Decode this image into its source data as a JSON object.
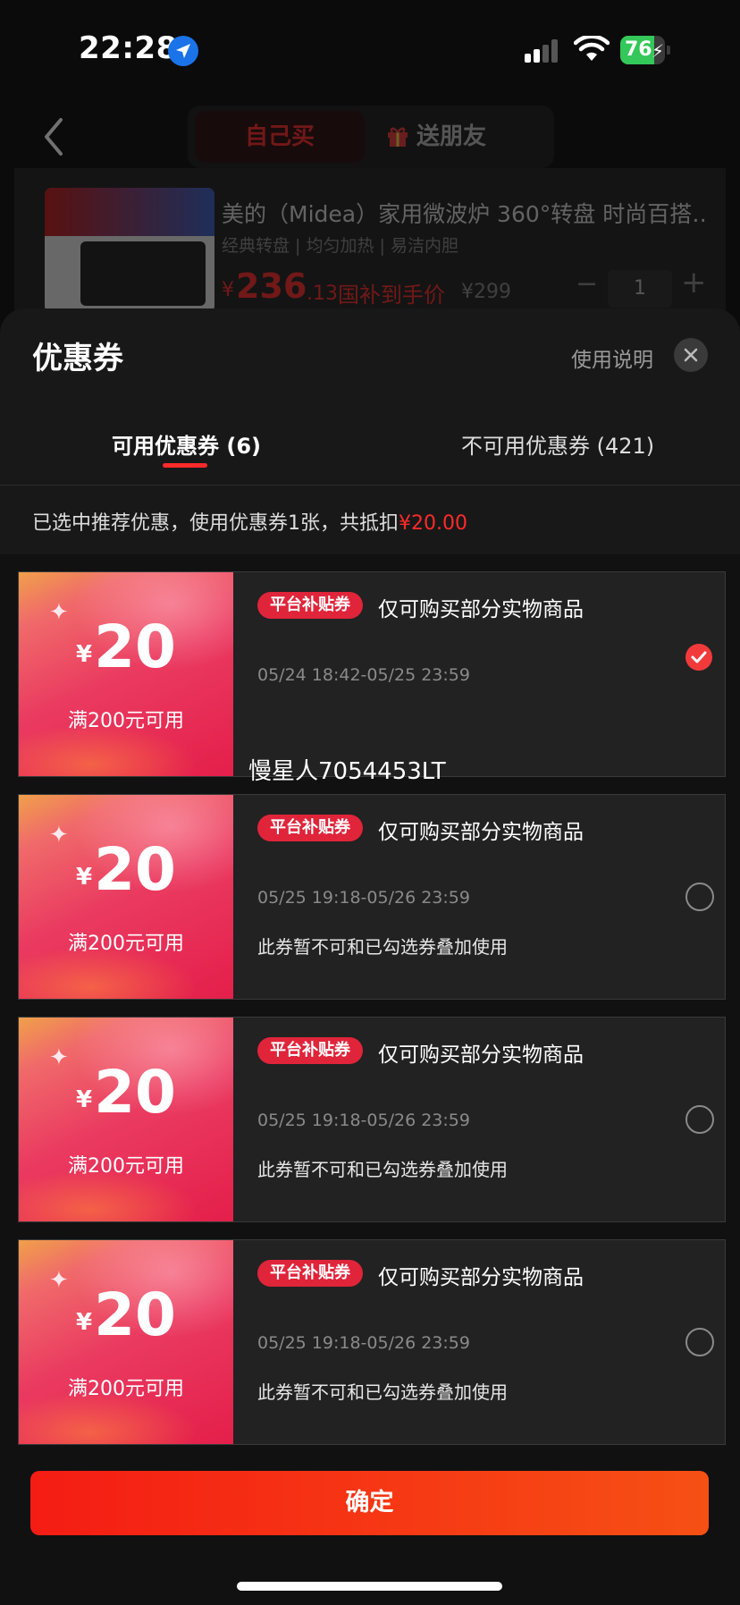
{
  "status_bar": {
    "time": "22:28",
    "battery": "76",
    "battery_level": 0.76
  },
  "background": {
    "tabs": {
      "self": "自己买",
      "gift": "送朋友"
    },
    "product": {
      "title": "美的（Midea）家用微波炉 360°转盘 时尚百搭…",
      "subtitle": "经典转盘 | 均匀加热 | 易洁内胆",
      "price_symbol": "¥",
      "price_int": "236",
      "price_dec": ".13",
      "price_note": "国补到手价",
      "original_price": "¥299",
      "quantity": "1",
      "minus": "−",
      "plus": "+"
    }
  },
  "sheet": {
    "title": "优惠券",
    "help": "使用说明",
    "tabs": {
      "available": "可用优惠券 (6)",
      "unavailable": "不可用优惠券 (421)"
    },
    "summary_prefix": "已选中推荐优惠，使用优惠券1张，共抵扣",
    "summary_amount": "¥20.00",
    "coupons": [
      {
        "symbol": "¥",
        "value": "20",
        "condition": "满200元可用",
        "tag": "平台补贴券",
        "scope": "仅可购买部分实物商品",
        "date": "05/24 18:42-05/25 23:59",
        "note": "",
        "selected": true
      },
      {
        "symbol": "¥",
        "value": "20",
        "condition": "满200元可用",
        "tag": "平台补贴券",
        "scope": "仅可购买部分实物商品",
        "date": "05/25 19:18-05/26 23:59",
        "note": "此券暂不可和已勾选券叠加使用",
        "selected": false
      },
      {
        "symbol": "¥",
        "value": "20",
        "condition": "满200元可用",
        "tag": "平台补贴券",
        "scope": "仅可购买部分实物商品",
        "date": "05/25 19:18-05/26 23:59",
        "note": "此券暂不可和已勾选券叠加使用",
        "selected": false
      },
      {
        "symbol": "¥",
        "value": "20",
        "condition": "满200元可用",
        "tag": "平台补贴券",
        "scope": "仅可购买部分实物商品",
        "date": "05/25 19:18-05/26 23:59",
        "note": "此券暂不可和已勾选券叠加使用",
        "selected": false
      }
    ],
    "watermark": "慢星人7054453LT",
    "confirm": "确定"
  },
  "colors": {
    "accent": "#ff2a2a",
    "button_start": "#f51c14",
    "button_end": "#f65014"
  },
  "icons": [
    "location-arrow-icon",
    "signal-icon",
    "wifi-icon",
    "battery-icon",
    "back-chevron-icon",
    "gift-icon",
    "close-icon",
    "checkmark-icon",
    "radio-empty-icon"
  ]
}
